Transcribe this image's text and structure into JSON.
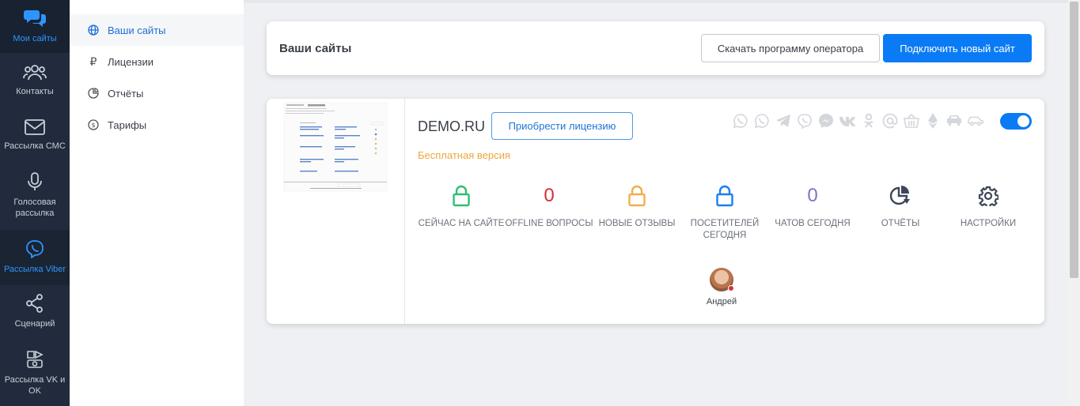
{
  "rail": {
    "items": [
      {
        "label": "Мои сайты",
        "icon": "chat-bubbles-icon"
      },
      {
        "label": "Контакты",
        "icon": "users-icon"
      },
      {
        "label": "Рассылка СМС",
        "icon": "envelope-icon"
      },
      {
        "label": "Голосовая рассылка",
        "icon": "microphone-icon"
      },
      {
        "label": "Рассылка Viber",
        "icon": "viber-icon"
      },
      {
        "label": "Сценарий",
        "icon": "share-nodes-icon"
      },
      {
        "label": "Рассылка VK и OK",
        "icon": "social-broadcast-icon"
      }
    ]
  },
  "submenu": {
    "items": [
      {
        "label": "Ваши сайты",
        "icon": "globe-icon"
      },
      {
        "label": "Лицензии",
        "icon": "ruble-icon"
      },
      {
        "label": "Отчёты",
        "icon": "pie-chart-icon"
      },
      {
        "label": "Тарифы",
        "icon": "dollar-circle-icon"
      }
    ]
  },
  "header": {
    "title": "Ваши сайты",
    "download_label": "Скачать программу оператора",
    "connect_label": "Подключить новый сайт"
  },
  "site": {
    "domain": "DEMO.RU",
    "buy_license_label": "Приобрести лицензию",
    "plan_label": "Бесплатная версия",
    "channel_icons": [
      "whatsapp-icon",
      "whatsapp-icon",
      "telegram-icon",
      "viber-icon",
      "messenger-icon",
      "vk-icon",
      "ok-icon",
      "email-icon",
      "basket-icon",
      "ethereum-icon",
      "car-icon",
      "car-icon"
    ],
    "enabled": true,
    "stats": [
      {
        "label": "Сейчас на сайте",
        "icon": "lock-green-icon"
      },
      {
        "label": "Offline вопросы",
        "value": "0",
        "color": "#d72e38"
      },
      {
        "label": "Новые отзывы",
        "icon": "lock-orange-icon"
      },
      {
        "label": "Посетителей сегодня",
        "icon": "lock-blue-icon"
      },
      {
        "label": "Чатов сегодня",
        "value": "0",
        "color": "#7a76c9"
      },
      {
        "label": "Отчёты",
        "icon": "pie-chart-icon"
      },
      {
        "label": "Настройки",
        "icon": "gear-icon"
      }
    ],
    "operator": {
      "name": "Андрей",
      "status_color": "#e02e3e"
    }
  },
  "colors": {
    "accent": "#0a7bf5",
    "rail": "#212b3d",
    "free_plan": "#f0a63a"
  }
}
